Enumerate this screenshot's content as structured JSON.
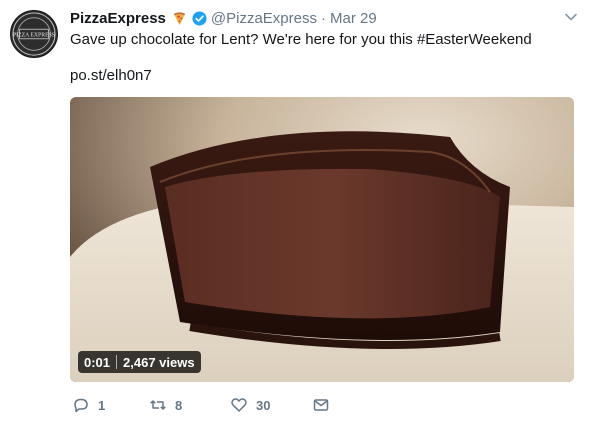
{
  "tweet": {
    "display_name": "PizzaExpress",
    "handle": "@PizzaExpress",
    "separator": "·",
    "date": "Mar 29",
    "text": "Gave up chocolate for Lent? We're here for you this #EasterWeekend",
    "link": "po.st/elh0n7",
    "avatar_text": "PIZZA EXPRESS"
  },
  "video": {
    "time": "0:01",
    "views": "2,467 views"
  },
  "actions": {
    "reply_count": "1",
    "retweet_count": "8",
    "like_count": "30"
  },
  "colors": {
    "verified": "#1da1f2",
    "secondary_text": "#657786"
  }
}
